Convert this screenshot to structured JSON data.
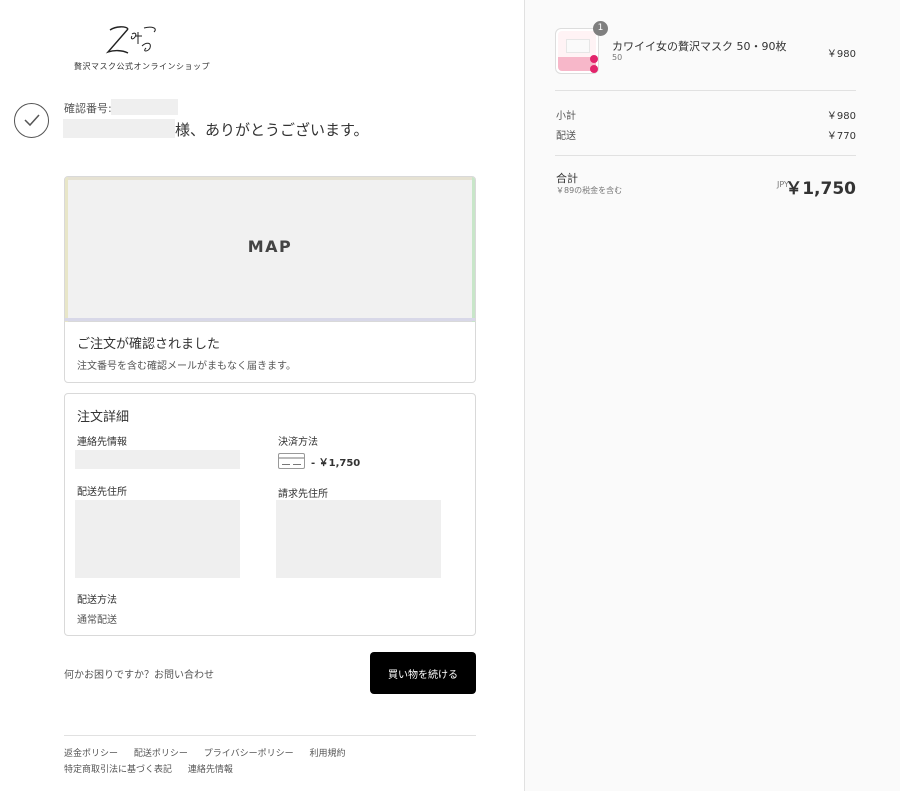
{
  "brand": {
    "tagline": "贅沢マスク公式オンラインショップ"
  },
  "confirmation": {
    "number_label": "確認番号:",
    "thanks_text": "様、ありがとうございます。"
  },
  "map": {
    "label": "MAP"
  },
  "order_confirmed": {
    "title": "ご注文が確認されました",
    "subtitle": "注文番号を含む確認メールがまもなく届きます。"
  },
  "order_details": {
    "title": "注文詳細",
    "contact_label": "連絡先情報",
    "payment_label": "決済方法",
    "payment_amount": "- ￥1,750",
    "shipping_address_label": "配送先住所",
    "billing_address_label": "請求先住所",
    "shipping_method_label": "配送方法",
    "shipping_method_value": "通常配送"
  },
  "help": {
    "text": "何かお困りですか？お問い合わせ"
  },
  "continue_button": {
    "label": "買い物を続ける"
  },
  "footer": {
    "links": [
      "返金ポリシー",
      "配送ポリシー",
      "プライバシーポリシー",
      "利用規約",
      "特定商取引法に基づく表記",
      "連絡先情報"
    ]
  },
  "summary": {
    "product": {
      "quantity": "1",
      "name": "カワイイ女の贅沢マスク 50・90枚",
      "variant": "50",
      "price": "￥980"
    },
    "subtotal_label": "小計",
    "subtotal_value": "￥980",
    "shipping_label": "配送",
    "shipping_value": "￥770",
    "total_label": "合計",
    "tax_note": "￥89の税金を含む",
    "currency": "JPY",
    "total_value": "￥1,750"
  }
}
